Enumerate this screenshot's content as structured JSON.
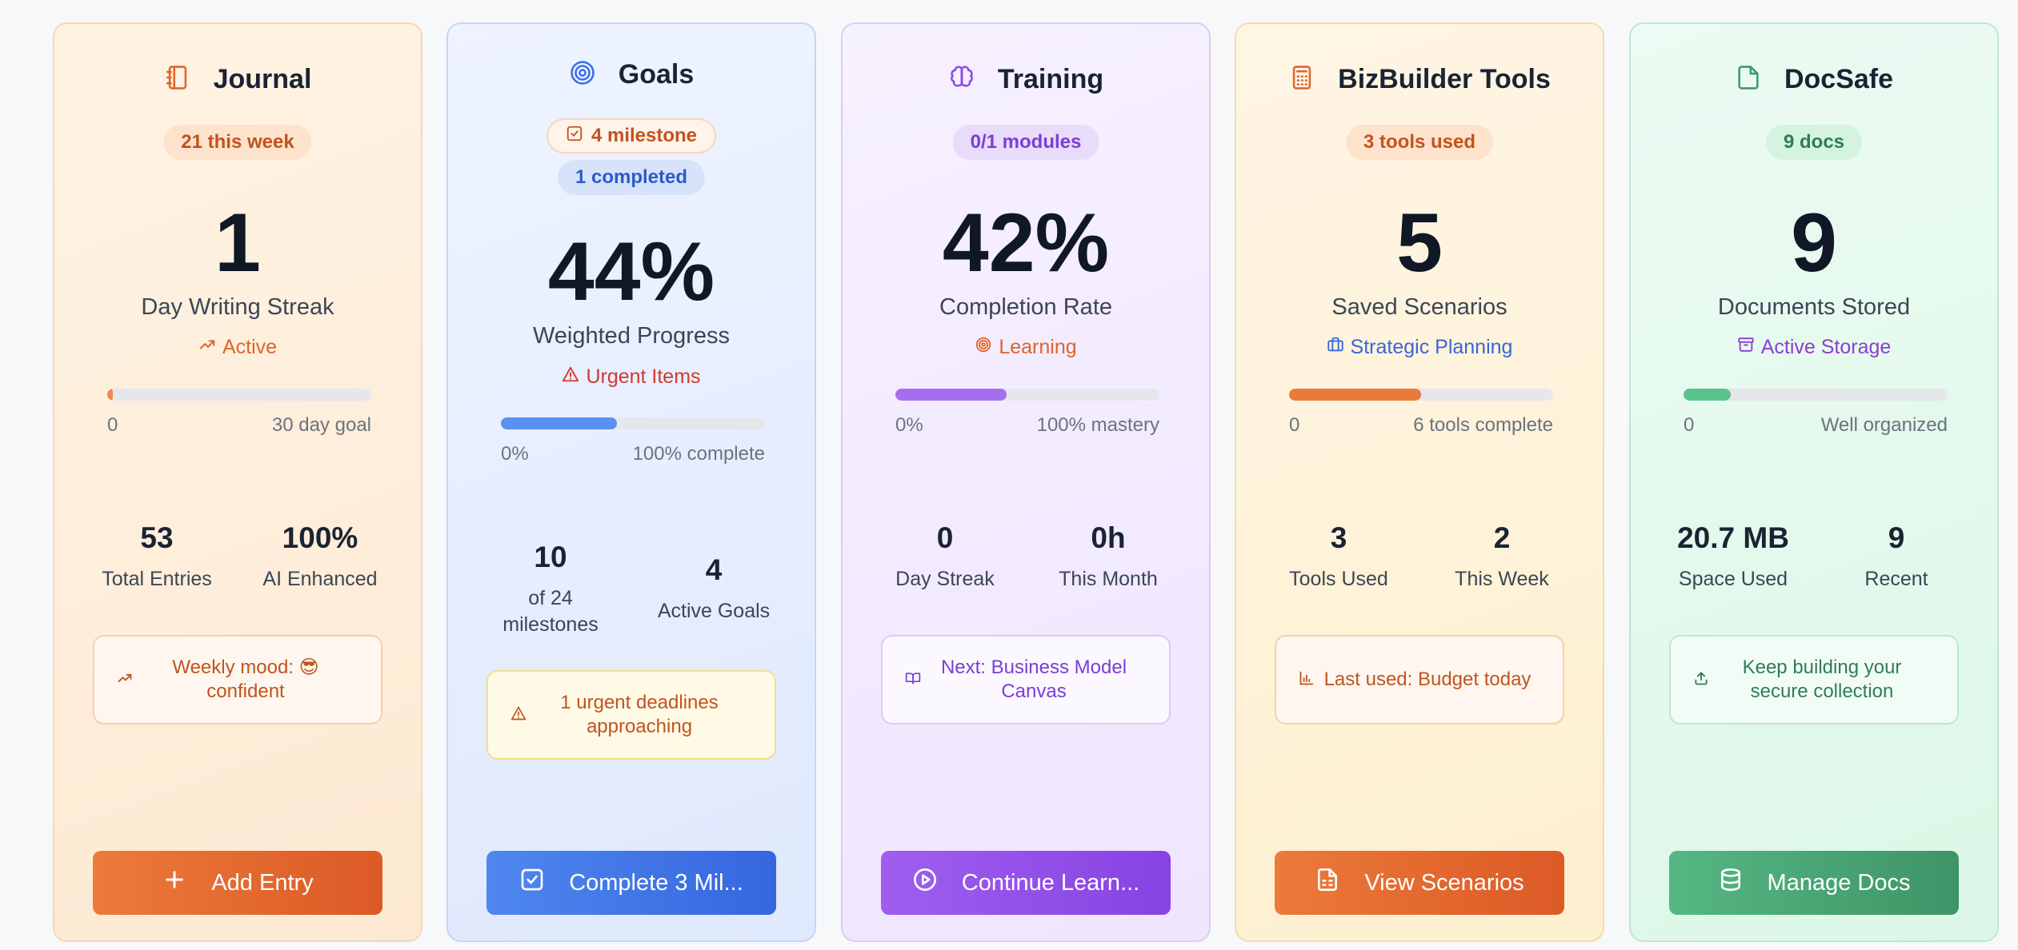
{
  "cards": [
    {
      "title": "Journal",
      "icon": "notebook-icon",
      "pill": "21 this week",
      "big": "1",
      "label": "Day Writing Streak",
      "status": "Active",
      "status_icon": "trending-up-icon",
      "progress": 0.02,
      "bar_left": "0",
      "bar_right": "30 day goal",
      "stats": [
        {
          "value": "53",
          "label": "Total Entries"
        },
        {
          "value": "100%",
          "label": "AI Enhanced"
        }
      ],
      "note": "Weekly mood: 😎 confident",
      "note_icon": "trending-up-icon",
      "button": "Add Entry",
      "button_icon": "plus-icon"
    },
    {
      "title": "Goals",
      "icon": "target-icon",
      "pill": "4 milestone",
      "pill_icon": "checkbox-icon",
      "pill2": "1 completed",
      "big": "44%",
      "label": "Weighted Progress",
      "status": "Urgent Items",
      "status_icon": "warning-icon",
      "progress": 0.44,
      "bar_left": "0%",
      "bar_right": "100% complete",
      "stats": [
        {
          "value": "10",
          "label": "of 24 milestones"
        },
        {
          "value": "4",
          "label": "Active Goals"
        }
      ],
      "note": "1 urgent deadlines approaching",
      "note_icon": "warning-icon",
      "button": "Complete 3 Mil...",
      "button_icon": "checkbox-icon"
    },
    {
      "title": "Training",
      "icon": "brain-icon",
      "pill": "0/1 modules",
      "big": "42%",
      "label": "Completion Rate",
      "status": "Learning",
      "status_icon": "target-icon",
      "progress": 0.42,
      "bar_left": "0%",
      "bar_right": "100% mastery",
      "stats": [
        {
          "value": "0",
          "label": "Day Streak"
        },
        {
          "value": "0h",
          "label": "This Month"
        }
      ],
      "note": "Next: Business Model Canvas",
      "note_icon": "book-open-icon",
      "button": "Continue Learn...",
      "button_icon": "play-circle-icon"
    },
    {
      "title": "BizBuilder Tools",
      "icon": "calculator-icon",
      "pill": "3 tools used",
      "big": "5",
      "label": "Saved Scenarios",
      "status": "Strategic Planning",
      "status_icon": "briefcase-icon",
      "progress": 0.5,
      "bar_left": "0",
      "bar_right": "6 tools complete",
      "stats": [
        {
          "value": "3",
          "label": "Tools Used"
        },
        {
          "value": "2",
          "label": "This Week"
        }
      ],
      "note": "Last used: Budget today",
      "note_icon": "bar-chart-icon",
      "button": "View Scenarios",
      "button_icon": "file-text-icon"
    },
    {
      "title": "DocSafe",
      "icon": "file-icon",
      "pill": "9 docs",
      "big": "9",
      "label": "Documents Stored",
      "status": "Active Storage",
      "status_icon": "archive-icon",
      "progress": 0.18,
      "bar_left": "0",
      "bar_right": "Well organized",
      "stats": [
        {
          "value": "20.7 MB",
          "label": "Space Used"
        },
        {
          "value": "9",
          "label": "Recent"
        }
      ],
      "note": "Keep building your secure collection",
      "note_icon": "upload-icon",
      "button": "Manage Docs",
      "button_icon": "database-icon"
    }
  ],
  "colors": {
    "journal_accent": "#e0642a",
    "goals_accent": "#3b6fe6",
    "training_accent": "#8b4ce8",
    "bizbuilder_accent": "#e06a2a",
    "docsafe_accent": "#3f9a6a",
    "urgent_red": "#d03a2f"
  }
}
